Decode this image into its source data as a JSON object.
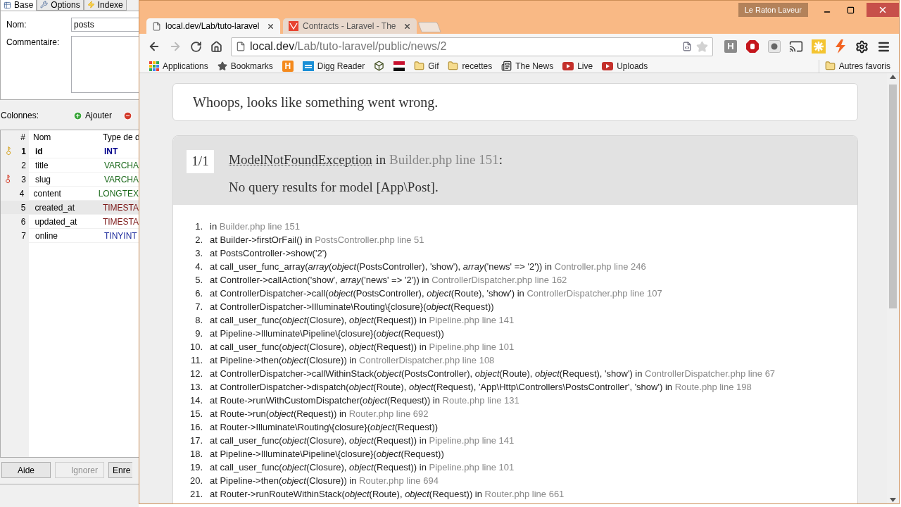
{
  "left_panel": {
    "tabs": [
      {
        "label": "Base",
        "selected": true
      },
      {
        "label": "Options",
        "selected": false
      },
      {
        "label": "Indexe",
        "selected": false
      }
    ],
    "name_label": "Nom:",
    "name_value": "posts",
    "comment_label": "Commentaire:",
    "columns_label": "Colonnes:",
    "add_button": "Ajouter",
    "table": {
      "columns": [
        "#",
        "Nom",
        "Type de d"
      ],
      "rows": [
        {
          "number": "1",
          "name": "id",
          "type": "INT",
          "color": "#00008b",
          "kind": "primary_key",
          "selected": false
        },
        {
          "number": "2",
          "name": "title",
          "type": "VARCHA",
          "color": "#1e6b1e",
          "kind": "plain",
          "selected": false
        },
        {
          "number": "3",
          "name": "slug",
          "type": "VARCHA",
          "color": "#1e6b1e",
          "kind": "unique_key",
          "selected": false
        },
        {
          "number": "4",
          "name": "content",
          "type": "LONGTEX",
          "color": "#1e6b1e",
          "kind": "plain",
          "selected": false
        },
        {
          "number": "5",
          "name": "created_at",
          "type": "TIMESTA",
          "color": "#7a1414",
          "kind": "plain",
          "selected": true
        },
        {
          "number": "6",
          "name": "updated_at",
          "type": "TIMESTA",
          "color": "#7a1414",
          "kind": "plain",
          "selected": false
        },
        {
          "number": "7",
          "name": "online",
          "type": "TINYINT",
          "color": "#1c2a9c",
          "kind": "plain",
          "selected": false
        }
      ]
    },
    "buttons": [
      {
        "label": "Aide",
        "disabled": false
      },
      {
        "label": "Ignorer",
        "disabled": true
      },
      {
        "label": "Enre",
        "disabled": false
      }
    ]
  },
  "browser": {
    "profile": "Le Raton Laveur",
    "tabs": [
      {
        "title": "local.dev/Lab/tuto-laravel",
        "kind": "page",
        "selected": true
      },
      {
        "title": "Contracts - Laravel - The",
        "kind": "laravel",
        "selected": false
      }
    ],
    "forward_disabled": true,
    "address": {
      "host": "local.dev",
      "path": "/Lab/tuto-laravel/public/news/2"
    },
    "bookmarks": [
      {
        "kind": "apps",
        "label": "Applications"
      },
      {
        "kind": "star",
        "label": "Bookmarks"
      },
      {
        "kind": "letter",
        "label": "H"
      },
      {
        "kind": "digg",
        "label": "Digg Reader"
      },
      {
        "kind": "cube"
      },
      {
        "kind": "flag"
      },
      {
        "kind": "folder",
        "label": "Gif"
      },
      {
        "kind": "folder",
        "label": "recettes"
      },
      {
        "kind": "news",
        "label": "The News"
      },
      {
        "kind": "video",
        "label": "Live"
      },
      {
        "kind": "video",
        "label": "Uploads"
      }
    ],
    "other_bookmarks": "Autres favoris",
    "extensions": [
      {
        "kind": "letter",
        "label": "H"
      },
      {
        "kind": "stop"
      },
      {
        "kind": "record"
      },
      {
        "kind": "cast"
      },
      {
        "kind": "spark"
      },
      {
        "kind": "bolt"
      }
    ]
  },
  "page": {
    "whoops": "Whoops, looks like something went wrong.",
    "counter": "1/1",
    "exception": "ModelNotFoundException",
    "exception_in": "in",
    "exception_location": "Builder.php line 151",
    "exception_suffix": ":",
    "message": "No query results for model [App\\Post].",
    "frames": [
      {
        "number": "1.",
        "call": "in",
        "location": "Builder.php line 151"
      },
      {
        "number": "2.",
        "call": "at Builder->firstOrFail() in",
        "location": "PostsController.php line 51"
      },
      {
        "number": "3.",
        "call": "at PostsController->show('2')"
      },
      {
        "number": "4.",
        "call": "at call_user_func_array(*array*(*object*(PostsController), 'show'), *array*('news' => '2')) in",
        "location": "Controller.php line 246"
      },
      {
        "number": "5.",
        "call": "at Controller->callAction('show', *array*('news' => '2')) in",
        "location": "ControllerDispatcher.php line 162"
      },
      {
        "number": "6.",
        "call": "at ControllerDispatcher->call(*object*(PostsController), *object*(Route), 'show') in",
        "location": "ControllerDispatcher.php line 107"
      },
      {
        "number": "7.",
        "call": "at ControllerDispatcher->Illuminate\\Routing\\{closure}(*object*(Request))"
      },
      {
        "number": "8.",
        "call": "at call_user_func(*object*(Closure), *object*(Request)) in",
        "location": "Pipeline.php line 141"
      },
      {
        "number": "9.",
        "call": "at Pipeline->Illuminate\\Pipeline\\{closure}(*object*(Request))"
      },
      {
        "number": "10.",
        "call": "at call_user_func(*object*(Closure), *object*(Request)) in",
        "location": "Pipeline.php line 101"
      },
      {
        "number": "11.",
        "call": "at Pipeline->then(*object*(Closure)) in",
        "location": "ControllerDispatcher.php line 108"
      },
      {
        "number": "12.",
        "call": "at ControllerDispatcher->callWithinStack(*object*(PostsController), *object*(Route), *object*(Request), 'show') in",
        "location": "ControllerDispatcher.php line 67"
      },
      {
        "number": "13.",
        "call": "at ControllerDispatcher->dispatch(*object*(Route), *object*(Request), 'App\\Http\\Controllers\\PostsController', 'show') in",
        "location": "Route.php line 198"
      },
      {
        "number": "14.",
        "call": "at Route->runWithCustomDispatcher(*object*(Request)) in",
        "location": "Route.php line 131"
      },
      {
        "number": "15.",
        "call": "at Route->run(*object*(Request)) in",
        "location": "Router.php line 692"
      },
      {
        "number": "16.",
        "call": "at Router->Illuminate\\Routing\\{closure}(*object*(Request))"
      },
      {
        "number": "17.",
        "call": "at call_user_func(*object*(Closure), *object*(Request)) in",
        "location": "Pipeline.php line 141"
      },
      {
        "number": "18.",
        "call": "at Pipeline->Illuminate\\Pipeline\\{closure}(*object*(Request))"
      },
      {
        "number": "19.",
        "call": "at call_user_func(*object*(Closure), *object*(Request)) in",
        "location": "Pipeline.php line 101"
      },
      {
        "number": "20.",
        "call": "at Pipeline->then(*object*(Closure)) in",
        "location": "Router.php line 694"
      },
      {
        "number": "21.",
        "call": "at Router->runRouteWithinStack(*object*(Route), *object*(Request)) in",
        "location": "Router.php line 661"
      }
    ]
  }
}
